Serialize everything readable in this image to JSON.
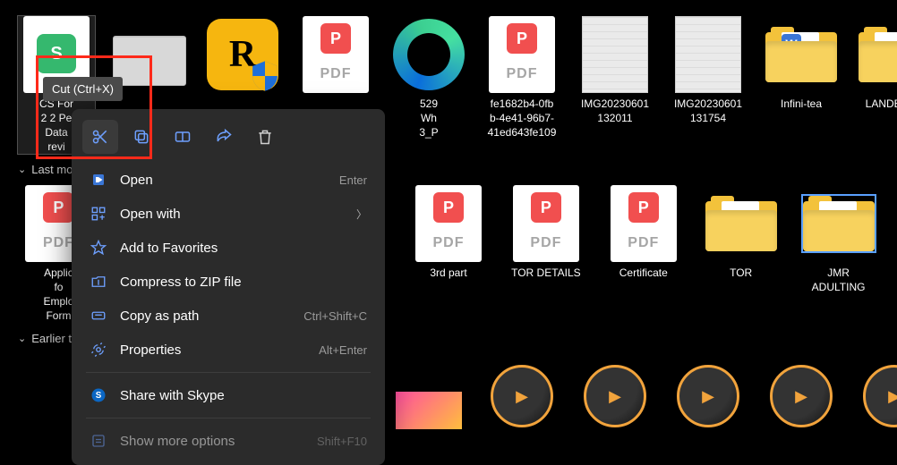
{
  "tooltip": "Cut (Ctrl+X)",
  "groups": {
    "last": "Last mo",
    "earlier": "Earlier t"
  },
  "row1": {
    "csform": "CS For\n2 2 Pe\nData\nrevi",
    "rockstar": "",
    "pdf1": "",
    "edge": "529\nWh\n3_P",
    "fe1682": "fe1682b4-0fb\nb-4e41-96b7-\n41ed643fe109",
    "img1": "IMG20230601\n132011",
    "img2": "IMG20230601\n131754",
    "infini": "Infini-tea",
    "landbank": "LANDBANK"
  },
  "row2": {
    "applic": "Applic\nfo\nEmplo\nForm",
    "thirdpart": "3rd part",
    "tordetails": "TOR DETAILS",
    "certificate": "Certificate",
    "tor": "TOR",
    "jmr": "JMR\nADULTING"
  },
  "menu": {
    "open": "Open",
    "open_accel": "Enter",
    "openwith": "Open with",
    "favorites": "Add to Favorites",
    "compress": "Compress to ZIP file",
    "copypath": "Copy as path",
    "copypath_accel": "Ctrl+Shift+C",
    "properties": "Properties",
    "properties_accel": "Alt+Enter",
    "skype": "Share with Skype",
    "showmore": "Show more options",
    "showmore_accel": "Shift+F10"
  }
}
